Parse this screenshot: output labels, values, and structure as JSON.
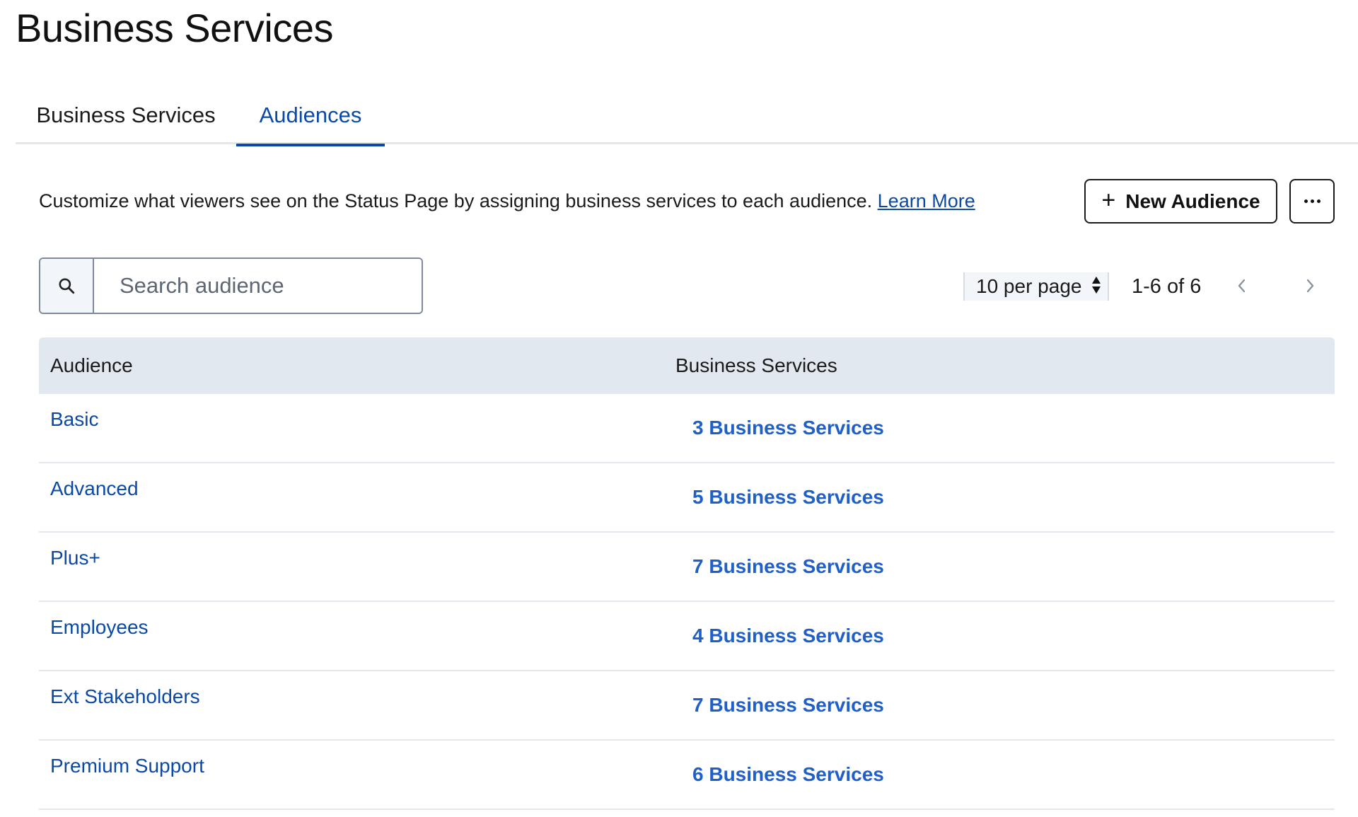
{
  "page": {
    "title": "Business Services"
  },
  "tabs": [
    {
      "label": "Business Services",
      "active": false
    },
    {
      "label": "Audiences",
      "active": true
    }
  ],
  "description": {
    "text": "Customize what viewers see on the Status Page by assigning business services to each audience. ",
    "link_label": "Learn More"
  },
  "actions": {
    "new_audience_label": "New Audience",
    "plus_icon": "+",
    "more_icon": "more-horizontal-icon"
  },
  "search": {
    "placeholder": "Search audience",
    "value": "",
    "icon": "search-icon"
  },
  "pagination": {
    "per_page_label": "10 per page",
    "range_label": "1-6 of 6",
    "prev_icon": "chevron-left-icon",
    "next_icon": "chevron-right-icon"
  },
  "table": {
    "columns": [
      "Audience",
      "Business Services"
    ],
    "rows": [
      {
        "audience": "Basic",
        "services": "3 Business Services"
      },
      {
        "audience": "Advanced",
        "services": "5 Business Services"
      },
      {
        "audience": "Plus+",
        "services": "7 Business Services"
      },
      {
        "audience": "Employees",
        "services": "4 Business Services"
      },
      {
        "audience": "Ext Stakeholders",
        "services": "7 Business Services"
      },
      {
        "audience": "Premium Support",
        "services": "6 Business Services"
      }
    ]
  },
  "colors": {
    "accent": "#0a4aa6",
    "link_bold": "#1f5fc9",
    "header_bg": "#e2e8f0",
    "border": "#7d8a9c"
  }
}
